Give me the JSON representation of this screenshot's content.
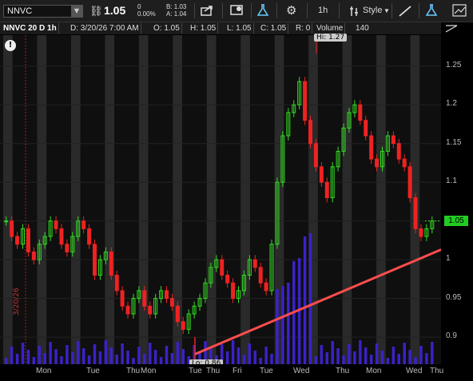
{
  "toolbar": {
    "symbol": "NNVC",
    "last": "1.05",
    "change": "0",
    "change_pct": "0.00%",
    "bid": "B: 1.03",
    "ask": "A: 1.04",
    "interval": "1h",
    "style_label": "Style",
    "icons": [
      "share-icon",
      "watchlist-icon",
      "flask-icon",
      "gear-icon",
      "interval-dropdown",
      "style-icon",
      "drawing-line-icon",
      "flask2-icon",
      "chart-grid-icon"
    ]
  },
  "infobar": {
    "title": "NNVC 20 D 1h",
    "date": "D: 3/20/26 7:00 AM",
    "open": "O: 1.05",
    "high": "H: 1.05",
    "low": "L: 1.05",
    "close": "C: 1.05",
    "range": "R: 0",
    "volume_label": "Volume",
    "volume_value": "140"
  },
  "hi_label": "Hi: 1.27",
  "lo_label": "Lo: 0.86",
  "side_date": "3/20/26",
  "price_box": "1.05",
  "chart_data": {
    "type": "candlestick",
    "symbol": "NNVC",
    "interval": "1h",
    "ylim": [
      0.865,
      1.29
    ],
    "yticks": [
      0.9,
      0.95,
      1,
      1.05,
      1.1,
      1.15,
      1.2,
      1.25
    ],
    "ytick_labels": [
      "0.9",
      "0.95",
      "1",
      "1.05",
      "1.1",
      "1.15",
      "1.2",
      "1.25"
    ],
    "x_labels": [
      "Mon",
      "Tue",
      "Thu",
      "Mon",
      "Tue",
      "Thu",
      "Fri",
      "Tue",
      "Wed",
      "Thu",
      "Mon",
      "Wed",
      "Thu"
    ],
    "high": 1.27,
    "low": 0.86,
    "last": 1.05,
    "close_series": [
      1.05,
      1.03,
      1.02,
      1.04,
      1.01,
      1.0,
      1.02,
      1.03,
      1.05,
      1.04,
      1.02,
      1.01,
      1.03,
      1.05,
      1.04,
      1.02,
      0.98,
      1.0,
      1.01,
      0.98,
      0.96,
      0.94,
      0.93,
      0.95,
      0.96,
      0.94,
      0.93,
      0.95,
      0.96,
      0.95,
      0.94,
      0.92,
      0.91,
      0.93,
      0.94,
      0.95,
      0.97,
      0.99,
      1.0,
      0.98,
      0.97,
      0.95,
      0.96,
      0.98,
      1.0,
      0.99,
      0.97,
      0.96,
      1.02,
      1.1,
      1.16,
      1.19,
      1.2,
      1.23,
      1.18,
      1.15,
      1.12,
      1.1,
      1.08,
      1.12,
      1.14,
      1.17,
      1.19,
      1.2,
      1.18,
      1.16,
      1.13,
      1.12,
      1.14,
      1.16,
      1.15,
      1.13,
      1.12,
      1.08,
      1.04,
      1.03,
      1.04,
      1.05
    ],
    "trendline": {
      "from": [
        0,
        0.878
      ],
      "to": [
        1,
        1.013
      ]
    }
  }
}
